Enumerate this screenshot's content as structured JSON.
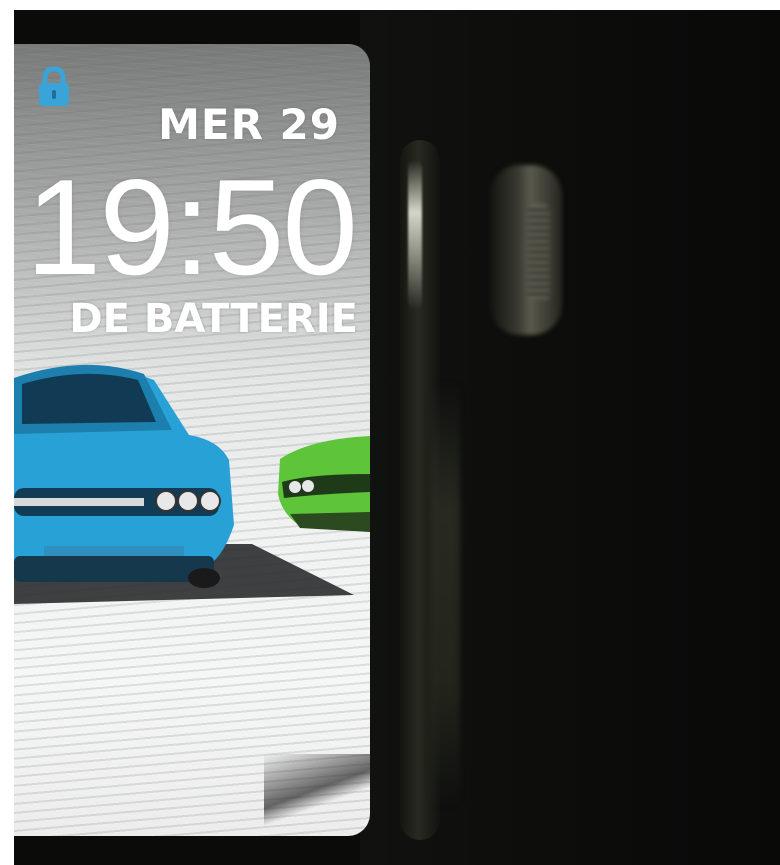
{
  "watch_face": {
    "date": "MER 29",
    "time": "19:50",
    "complication": "DE BATTERIE"
  },
  "colors": {
    "lock_icon": "#3aa3d8",
    "text": "#ffffff",
    "blue_car": "#28a2d6",
    "green_car": "#5ec43a",
    "watch_body": "#0b0b0a"
  },
  "icons": {
    "lock": "lock-icon",
    "crown": "digital-crown"
  }
}
